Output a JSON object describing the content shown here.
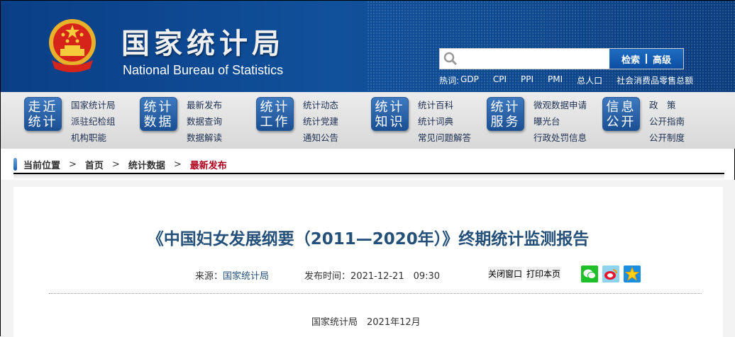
{
  "header": {
    "title_cn": "国家统计局",
    "title_en": "National Bureau of Statistics",
    "search": {
      "placeholder": "",
      "search_label": "检索",
      "advanced_label": "高级"
    },
    "hot_label": "热词:",
    "hot_words": [
      "GDP",
      "CPI",
      "PPI",
      "PMI",
      "总人口",
      "社会消费品零售总额"
    ]
  },
  "nav": [
    {
      "badge": [
        "走近",
        "统计"
      ],
      "links": [
        "国家统计局",
        "派驻纪检组",
        "机构职能"
      ]
    },
    {
      "badge": [
        "统计",
        "数据"
      ],
      "links": [
        "最新发布",
        "数据查询",
        "数据解读"
      ]
    },
    {
      "badge": [
        "统计",
        "工作"
      ],
      "links": [
        "统计动态",
        "统计党建",
        "通知公告"
      ]
    },
    {
      "badge": [
        "统计",
        "知识"
      ],
      "links": [
        "统计百科",
        "统计词典",
        "常见问题解答"
      ]
    },
    {
      "badge": [
        "统计",
        "服务"
      ],
      "links": [
        "微观数据申请",
        "曝光台",
        "行政处罚信息"
      ]
    },
    {
      "badge": [
        "信息",
        "公开"
      ],
      "links": [
        "政　策",
        "公开指南",
        "公开制度"
      ]
    }
  ],
  "breadcrumb": {
    "label": "当前位置",
    "sep": ">",
    "items": [
      "首页",
      "统计数据"
    ],
    "current": "最新发布"
  },
  "article": {
    "title": "《中国妇女发展纲要（2011—2020年）》终期统计监测报告",
    "source_label": "来源：",
    "source": "国家统计局",
    "time_label": "发布时间：",
    "time": "2021-12-21　09:30",
    "close_label": "关闭窗口",
    "print_label": "打印本页",
    "share_icons": [
      "wechat-icon",
      "weibo-icon",
      "qzone-icon"
    ],
    "byline": "国家统计局　2021年12月"
  },
  "colors": {
    "header_blue": "#11509b",
    "title_blue": "#24507a",
    "crumb_current": "#b0001b"
  }
}
